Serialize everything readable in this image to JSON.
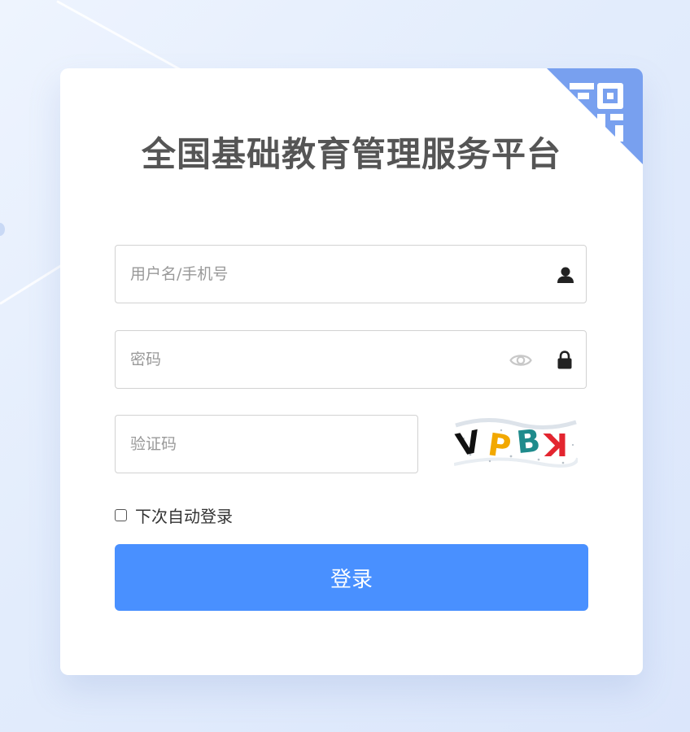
{
  "page": {
    "title": "全国基础教育管理服务平台"
  },
  "form": {
    "username": {
      "placeholder": "用户名/手机号",
      "value": ""
    },
    "password": {
      "placeholder": "密码",
      "value": ""
    },
    "captcha": {
      "placeholder": "验证码",
      "value": "",
      "image_text": "VPBK"
    },
    "remember_label": "下次自动登录",
    "remember_checked": false,
    "submit_label": "登录"
  },
  "icons": {
    "qr_corner": "qr-code-icon",
    "username": "user-icon",
    "password_toggle": "eye-icon",
    "password": "lock-icon"
  },
  "colors": {
    "accent": "#4990ff",
    "qr_corner": "#78a0ef",
    "title": "#555555",
    "captcha_chars": [
      "#111111",
      "#f2a800",
      "#1f8b8c",
      "#e3252f"
    ]
  }
}
